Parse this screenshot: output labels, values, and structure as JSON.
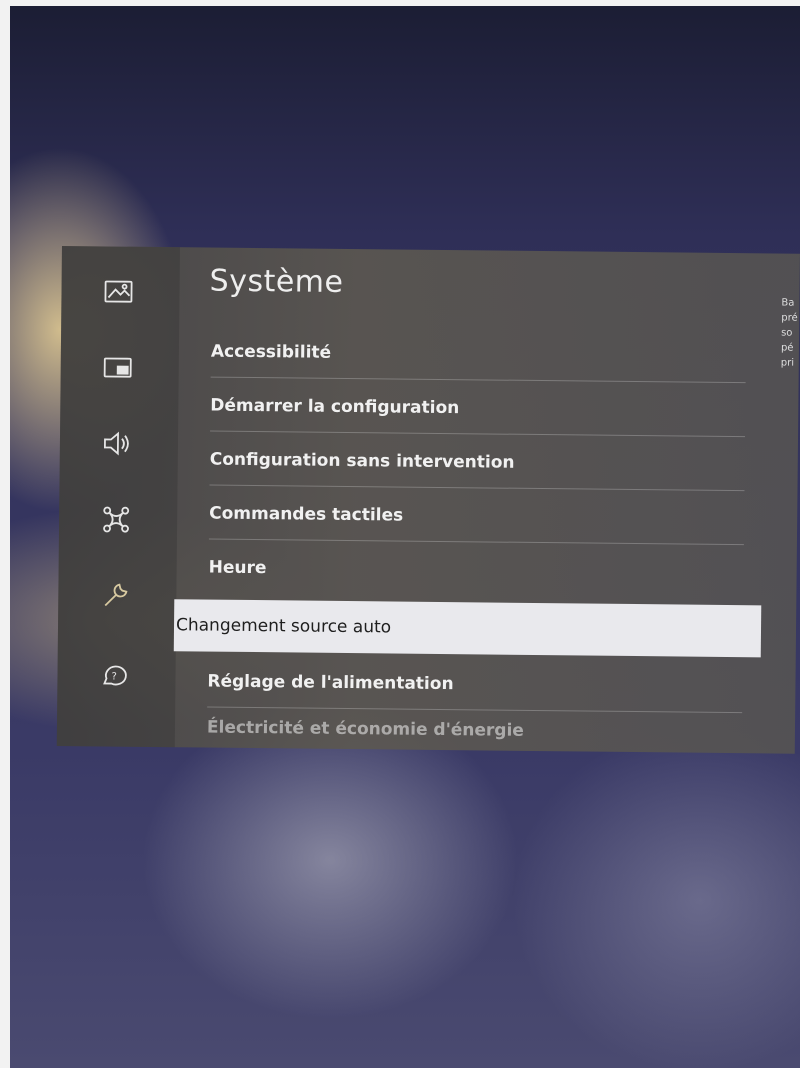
{
  "panel": {
    "title": "Système",
    "rail_icons": [
      "picture-icon",
      "pip-icon",
      "sound-icon",
      "network-icon",
      "wrench-icon",
      "support-icon"
    ],
    "items": [
      {
        "label": "Accessibilité"
      },
      {
        "label": "Démarrer la configuration"
      },
      {
        "label": "Configuration sans intervention"
      },
      {
        "label": "Commandes tactiles"
      },
      {
        "label": "Heure"
      },
      {
        "label": "Changement source auto",
        "selected": true
      },
      {
        "label": "Réglage de l'alimentation"
      },
      {
        "label": "Électricité et économie d'énergie"
      }
    ],
    "description_lines": [
      "Ba",
      "pré",
      "so",
      "pé",
      "pri"
    ]
  }
}
